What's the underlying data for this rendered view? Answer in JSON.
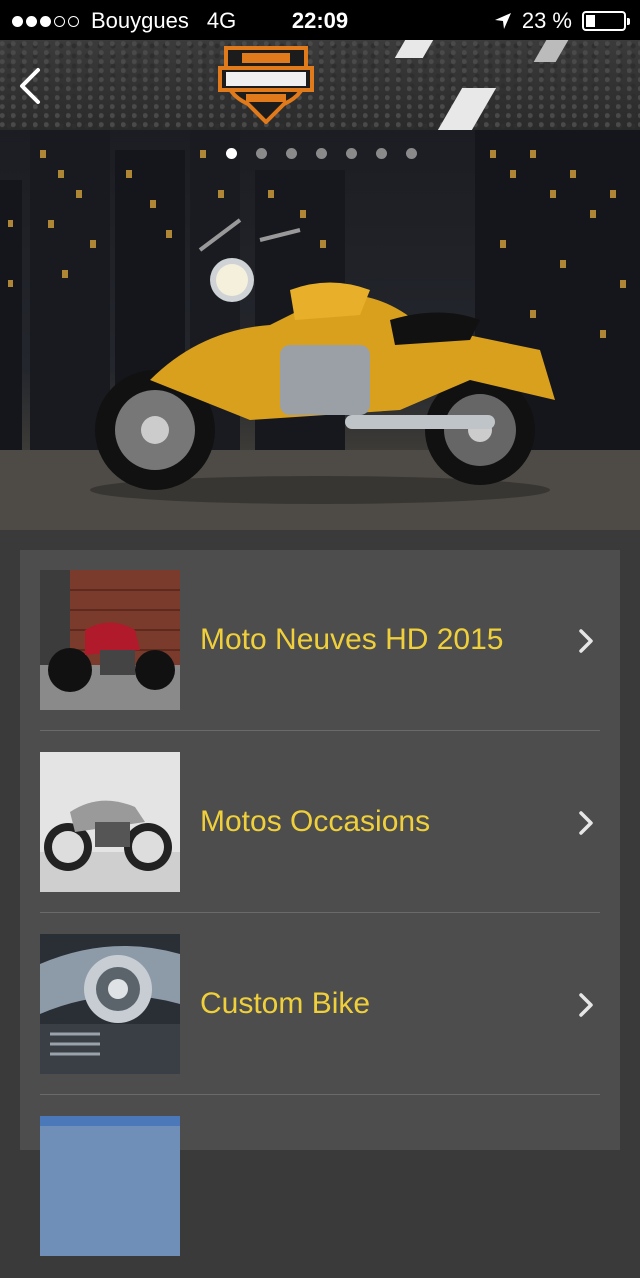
{
  "status_bar": {
    "carrier": "Bouygues",
    "network": "4G",
    "time": "22:09",
    "battery": "23 %"
  },
  "header": {
    "back_icon": "chevron-left-icon",
    "logo": "harley-davidson-logo"
  },
  "hero": {
    "pages_total": 7,
    "active_page": 1
  },
  "menu": {
    "items": [
      {
        "label": "Moto Neuves HD 2015",
        "thumb": "red-motorcycle"
      },
      {
        "label": "Motos Occasions",
        "thumb": "vintage-motorcycle"
      },
      {
        "label": "Custom Bike",
        "thumb": "chrome-engine"
      }
    ]
  },
  "colors": {
    "label": "#f0d03a",
    "panel": "#4d4d4d",
    "background": "#3a3a3a"
  }
}
